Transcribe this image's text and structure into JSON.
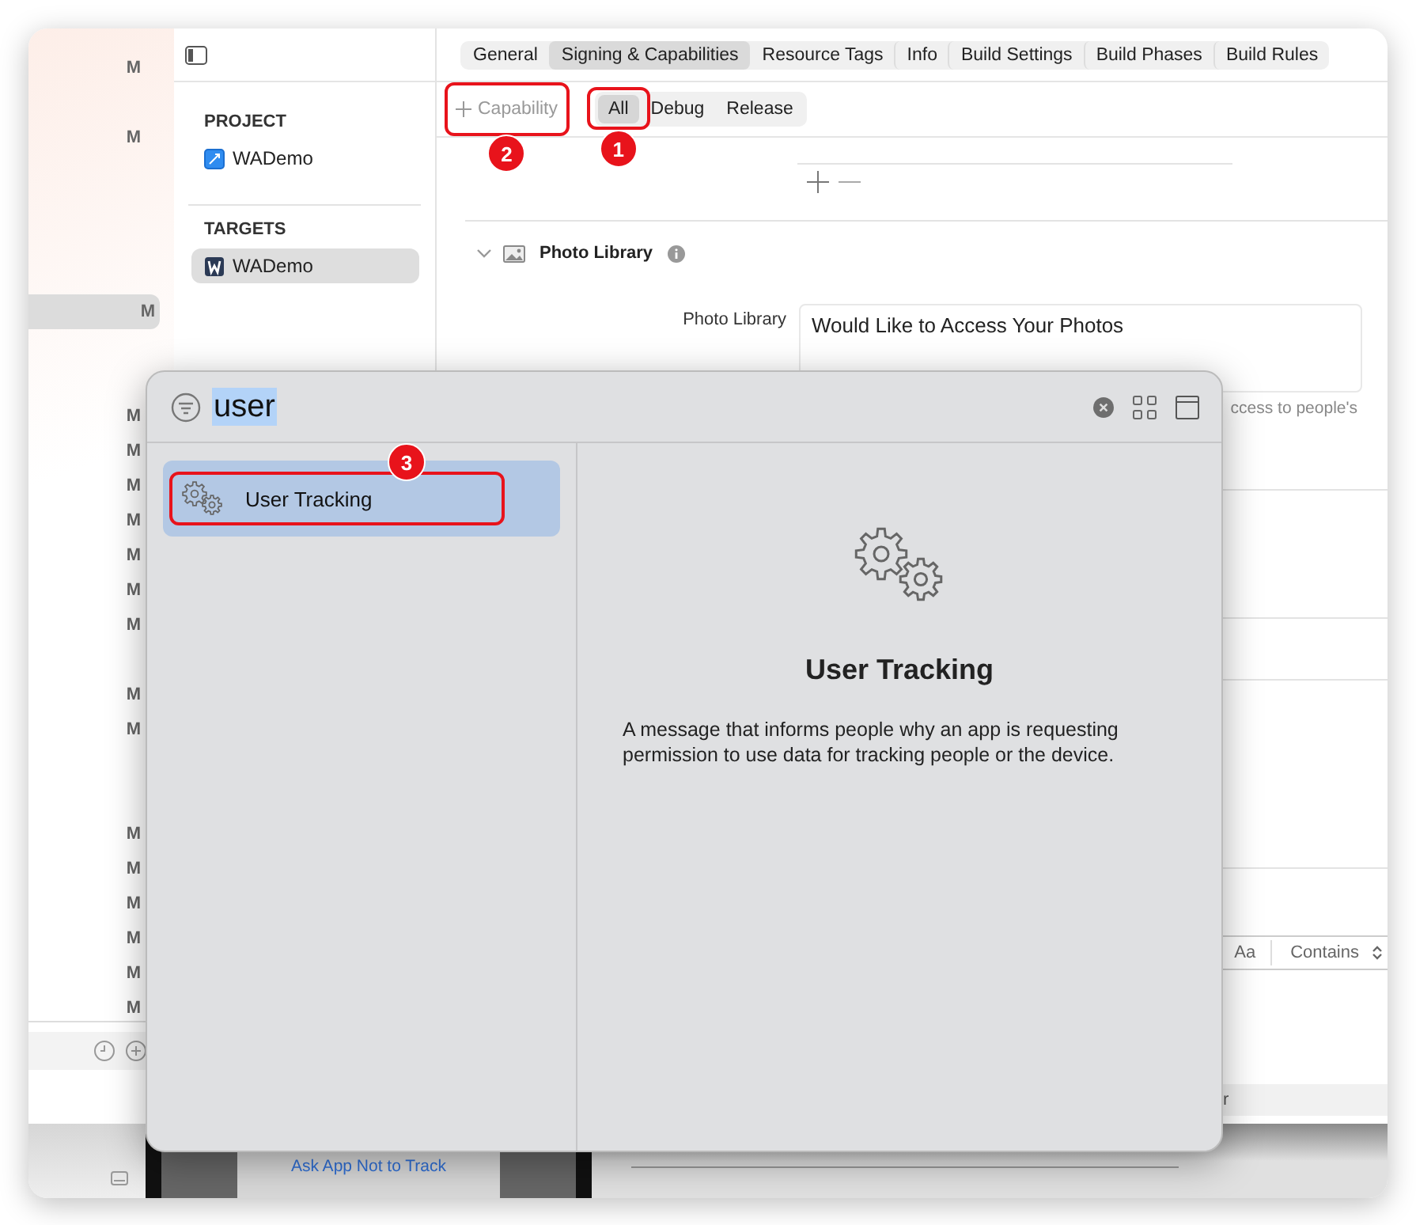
{
  "status_marks": [
    {
      "text": "M",
      "selected": false
    },
    {
      "text": "M",
      "selected": false
    },
    {
      "text": "M",
      "selected": true
    },
    {
      "text": "M",
      "selected": false
    },
    {
      "text": "M",
      "selected": false
    },
    {
      "text": "M",
      "selected": false
    },
    {
      "text": "M",
      "selected": false
    },
    {
      "text": "M",
      "selected": false
    },
    {
      "text": "M",
      "selected": false
    },
    {
      "text": "M",
      "selected": false
    },
    {
      "text": "M",
      "selected": false
    },
    {
      "text": "M",
      "selected": false
    },
    {
      "text": "M",
      "selected": false
    },
    {
      "text": "M",
      "selected": false
    },
    {
      "text": "M",
      "selected": false
    },
    {
      "text": "M",
      "selected": false
    },
    {
      "text": "M",
      "selected": false
    },
    {
      "text": "M",
      "selected": false
    }
  ],
  "navigator": {
    "sections": [
      {
        "heading": "PROJECT",
        "items": [
          {
            "label": "WADemo",
            "kind": "project",
            "selected": false
          }
        ]
      },
      {
        "heading": "TARGETS",
        "items": [
          {
            "label": "WADemo",
            "kind": "target",
            "selected": true
          }
        ]
      }
    ]
  },
  "editor_tabs": [
    {
      "label": "General",
      "selected": false
    },
    {
      "label": "Signing & Capabilities",
      "selected": true
    },
    {
      "label": "Resource Tags",
      "selected": false
    },
    {
      "label": "Info",
      "selected": false
    },
    {
      "label": "Build Settings",
      "selected": false
    },
    {
      "label": "Build Phases",
      "selected": false
    },
    {
      "label": "Build Rules",
      "selected": false
    }
  ],
  "capability_button": {
    "label": "Capability",
    "annotation": "2"
  },
  "configurations": [
    {
      "label": "All",
      "selected": true,
      "annotation": "1"
    },
    {
      "label": "Debug",
      "selected": false
    },
    {
      "label": "Release",
      "selected": false
    }
  ],
  "photo_library": {
    "title": "Photo Library",
    "expanded": true,
    "field_label": "Photo Library",
    "value": "Would Like to Access Your Photos",
    "hint": "ccess to people's"
  },
  "find_bar": {
    "case_toggle": "Aa",
    "match_mode": "Contains"
  },
  "status_text": "r",
  "preview_link": "Ask App Not to Track",
  "library_popup": {
    "query": "user",
    "results": [
      {
        "label": "User Tracking",
        "selected": true,
        "annotation": "3"
      }
    ],
    "detail": {
      "title": "User Tracking",
      "description": "A message that informs people why an app is requesting permission to use data for tracking people or the device."
    }
  }
}
